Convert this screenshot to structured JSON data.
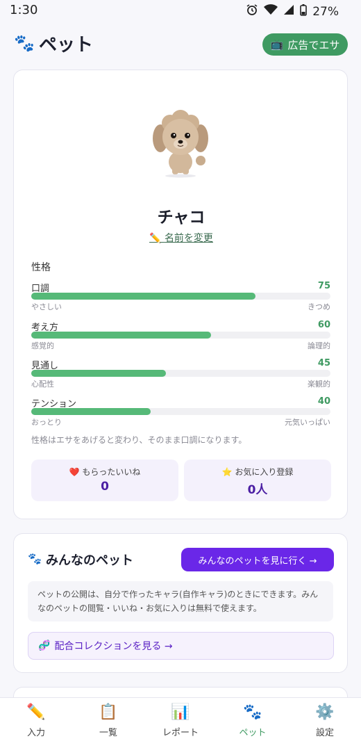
{
  "status_bar": {
    "time": "1:30",
    "battery": "27%"
  },
  "header": {
    "paw_icon": "🐾",
    "title": "ペット",
    "ad_button": {
      "icon": "📺",
      "label": "広告でエサ"
    }
  },
  "pet": {
    "name": "チャコ",
    "rename_icon": "✏️",
    "rename_label": "名前を変更",
    "personality_label": "性格",
    "traits": [
      {
        "name": "口調",
        "value": 75,
        "value_text": "75",
        "low": "やさしい",
        "high": "きつめ"
      },
      {
        "name": "考え方",
        "value": 60,
        "value_text": "60",
        "low": "感覚的",
        "high": "論理的"
      },
      {
        "name": "見通し",
        "value": 45,
        "value_text": "45",
        "low": "心配性",
        "high": "楽観的"
      },
      {
        "name": "テンション",
        "value": 40,
        "value_text": "40",
        "low": "おっとり",
        "high": "元気いっぱい"
      }
    ],
    "note": "性格はエサをあげると変わり、そのまま口調になります。",
    "stats": [
      {
        "icon": "❤️",
        "label": "もらったいいね",
        "value": "0"
      },
      {
        "icon": "⭐",
        "label": "お気に入り登録",
        "value": "0人"
      }
    ]
  },
  "community": {
    "paw_icon": "🐾",
    "title": "みんなのペット",
    "button_label": "みんなのペットを見に行く →",
    "info": "ペットの公開は、自分で作ったキャラ(自作キャラ)のときにできます。みんなのペットの閲覧・いいね・お気に入りは無料で使えます。",
    "collection_icon": "🧬",
    "collection_label": "配合コレクションを見る →"
  },
  "bottom_nav": [
    {
      "icon": "✏️",
      "label": "入力"
    },
    {
      "icon": "📋",
      "label": "一覧"
    },
    {
      "icon": "📊",
      "label": "レポート"
    },
    {
      "icon": "🐾",
      "label": "ペット"
    },
    {
      "icon": "⚙️",
      "label": "設定"
    }
  ],
  "colors": {
    "accent_green": "#3f9a62",
    "bar_green": "#56b978",
    "purple": "#6a27e8"
  }
}
